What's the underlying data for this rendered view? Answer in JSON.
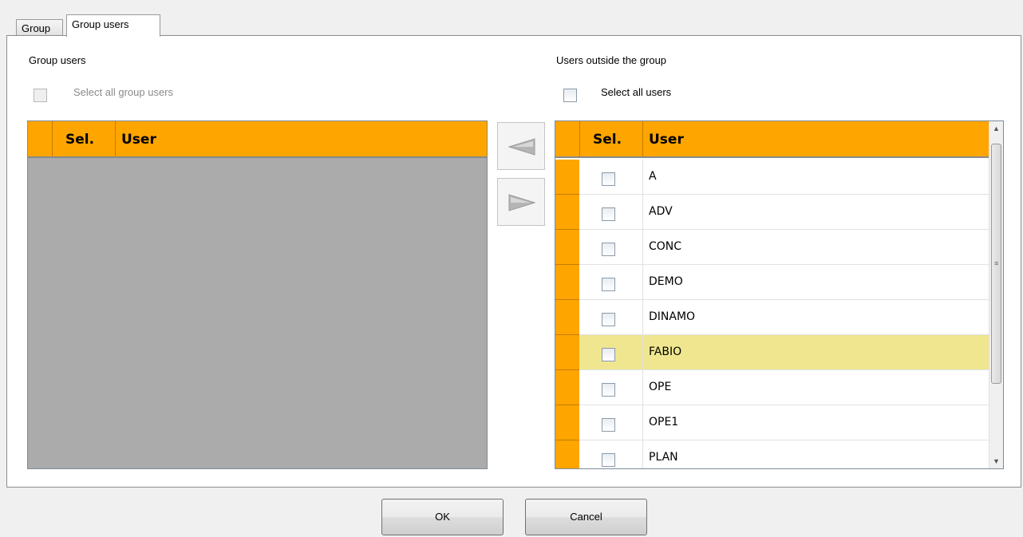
{
  "tabs": [
    {
      "label": "Group",
      "active": false
    },
    {
      "label": "Group users",
      "active": true
    }
  ],
  "group_users": {
    "title": "Group users",
    "select_all_label": "Select all group users",
    "columns": {
      "sel": "Sel.",
      "user": "User"
    },
    "rows": []
  },
  "outside_users": {
    "title": "Users outside the group",
    "select_all_label": "Select all users",
    "columns": {
      "sel": "Sel.",
      "user": "User"
    },
    "rows": [
      {
        "user": "A",
        "selected": false
      },
      {
        "user": "ADV",
        "selected": false
      },
      {
        "user": "CONC",
        "selected": false
      },
      {
        "user": "DEMO",
        "selected": false
      },
      {
        "user": "DINAMO",
        "selected": false
      },
      {
        "user": "FABIO",
        "selected": false,
        "highlighted": true
      },
      {
        "user": "OPE",
        "selected": false
      },
      {
        "user": "OPE1",
        "selected": false
      },
      {
        "user": "PLAN",
        "selected": false
      }
    ],
    "highlight_color": "#efe68f"
  },
  "icons": {
    "move_left": "left-triangle-arrow-icon",
    "move_right": "right-triangle-arrow-icon",
    "scroll_up": "scroll-up-icon",
    "scroll_down": "scroll-down-icon"
  },
  "buttons": {
    "ok": "OK",
    "cancel": "Cancel"
  },
  "colors": {
    "header": "#ffa500",
    "empty_grid": "#ababab"
  }
}
